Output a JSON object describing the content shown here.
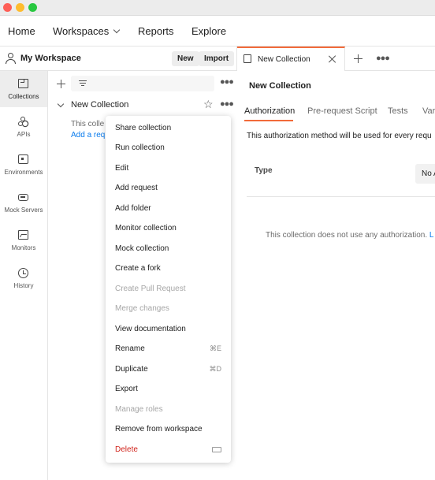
{
  "topnav": {
    "home": "Home",
    "workspaces": "Workspaces",
    "reports": "Reports",
    "explore": "Explore"
  },
  "workspace": {
    "title": "My Workspace",
    "new_label": "New",
    "import_label": "Import"
  },
  "rail": {
    "items": [
      {
        "label": "Collections",
        "icon": "collections-icon",
        "active": true
      },
      {
        "label": "APIs",
        "icon": "apis-icon"
      },
      {
        "label": "Environments",
        "icon": "environments-icon"
      },
      {
        "label": "Mock Servers",
        "icon": "mock-servers-icon"
      },
      {
        "label": "Monitors",
        "icon": "monitors-icon"
      },
      {
        "label": "History",
        "icon": "history-icon"
      }
    ]
  },
  "sidebar": {
    "collection_name": "New Collection",
    "collection_desc": "This colle",
    "collection_link": "Add a req"
  },
  "context_menu": {
    "items": [
      {
        "label": "Share collection"
      },
      {
        "label": "Run collection"
      },
      {
        "label": "Edit"
      },
      {
        "label": "Add request"
      },
      {
        "label": "Add folder"
      },
      {
        "label": "Monitor collection"
      },
      {
        "label": "Mock collection"
      },
      {
        "label": "Create a fork"
      },
      {
        "label": "Create Pull Request",
        "disabled": true
      },
      {
        "label": "Merge changes",
        "disabled": true
      },
      {
        "label": "View documentation"
      },
      {
        "label": "Rename",
        "shortcut": "⌘E"
      },
      {
        "label": "Duplicate",
        "shortcut": "⌘D"
      },
      {
        "label": "Export"
      },
      {
        "label": "Manage roles",
        "disabled": true
      },
      {
        "label": "Remove from workspace"
      },
      {
        "label": "Delete",
        "danger": true,
        "shortcut_icon": "delete-key-icon"
      }
    ]
  },
  "tab": {
    "label": "New Collection"
  },
  "main": {
    "title": "New Collection",
    "tabs": [
      "Authorization",
      "Pre-request Script",
      "Tests",
      "Vari"
    ],
    "auth_desc": "This authorization method will be used for every requ",
    "type_label": "Type",
    "type_value": "No A",
    "no_auth_text": "This collection does not use any authorization. ",
    "no_auth_link": "L"
  },
  "colors": {
    "accent": "#f26b3a",
    "link": "#097bed",
    "danger": "#d1241c"
  }
}
